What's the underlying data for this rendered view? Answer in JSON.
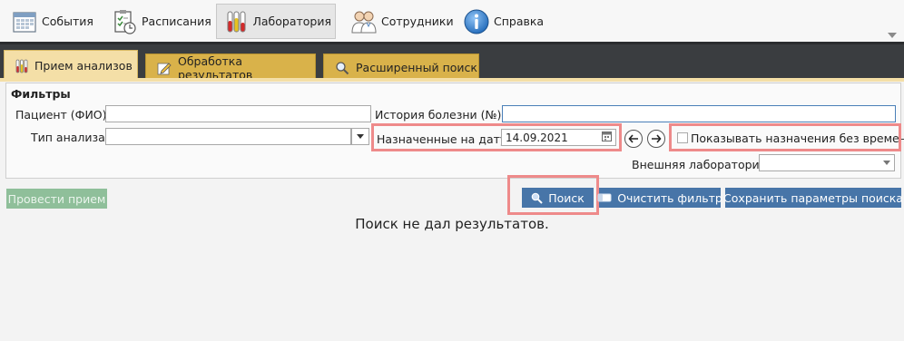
{
  "toolbar": {
    "items": [
      {
        "label": "События",
        "icon": "calendar-icon"
      },
      {
        "label": "Расписания",
        "icon": "schedule-icon"
      },
      {
        "label": "Лаборатория",
        "icon": "test-tubes-icon",
        "active": true
      },
      {
        "label": "Сотрудники",
        "icon": "staff-icon"
      },
      {
        "label": "Справка",
        "icon": "info-icon"
      }
    ]
  },
  "tabs": [
    {
      "label": "Прием анализов",
      "icon": "test-tubes-icon",
      "active": true
    },
    {
      "label": "Обработка результатов",
      "icon": "pencil-icon"
    },
    {
      "label": "Расширенный поиск",
      "icon": "magnifier-icon"
    }
  ],
  "filters": {
    "title": "Фильтры",
    "patient_label": "Пациент (ФИО):",
    "patient_value": "",
    "history_label": "История болезни (№):",
    "history_value": "",
    "analysis_type_label": "Тип анализа:",
    "analysis_type_value": "",
    "date_label": "Назначенные на дату:",
    "date_value": "14.09.2021",
    "show_no_time_label": "Показывать назначения без времени",
    "show_no_time_checked": false,
    "external_lab_label": "Внешняя лаборатория:",
    "external_lab_value": ""
  },
  "actions": {
    "conduct": "Провести прием",
    "search": "Поиск",
    "clear": "Очистить фильтр",
    "save": "Сохранить параметры поиска"
  },
  "result_text": "Поиск не дал результатов.",
  "colors": {
    "tab_strip": "#3a3d40",
    "tab": "#d9b24a",
    "tab_active": "#f4dfa7",
    "button_blue": "#4775a8",
    "button_green": "#8fbf9a",
    "highlight": "#ee8a8a"
  }
}
